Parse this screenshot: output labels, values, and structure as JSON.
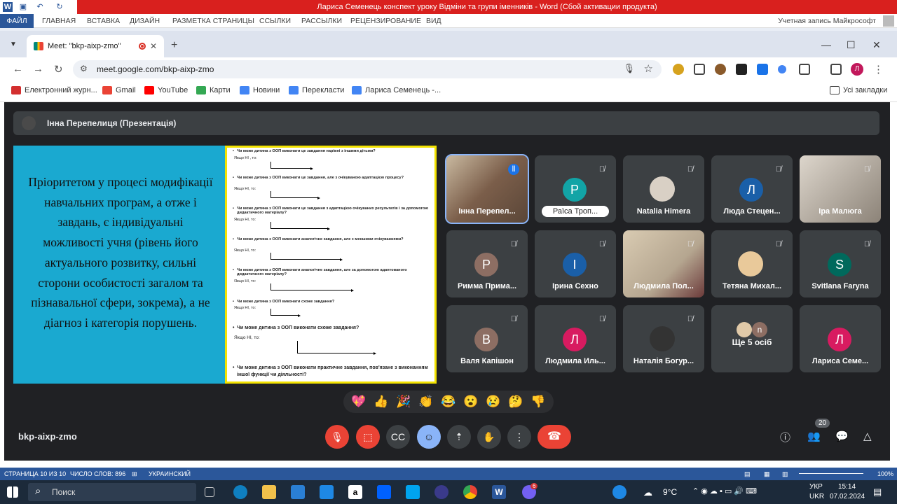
{
  "word": {
    "title": "Лариса Семенець конспект уроку Відміни та групи іменників  -  Word (Сбой активации продукта)",
    "file_tab": "ФАЙЛ",
    "tabs": [
      "ГЛАВНАЯ",
      "ВСТАВКА",
      "ДИЗАЙН",
      "РАЗМЕТКА СТРАНИЦЫ",
      "ССЫЛКИ",
      "РАССЫЛКИ",
      "РЕЦЕНЗИРОВАНИЕ",
      "ВИД"
    ],
    "account": "Учетная запись Майкрософт",
    "status": {
      "page": "СТРАНИЦА 10 ИЗ 10",
      "words": "ЧИСЛО СЛОВ: 896",
      "language": "УКРАИНСКИЙ",
      "zoom": "100%"
    }
  },
  "browser": {
    "tab_title": "Meet: \"bkp-aixp-zmo\"",
    "url": "meet.google.com/bkp-aixp-zmo",
    "profile_letter": "Л",
    "bookmarks": [
      "Електронний журн...",
      "Gmail",
      "YouTube",
      "Карти",
      "Новини",
      "Перекласти",
      "Лариса Семенець -..."
    ],
    "all_bookmarks": "Усі закладки"
  },
  "meet": {
    "presenter": "Інна Перепелиця (Презентація)",
    "slide_text": "Пріоритетом у процесі модифікації навчальних програм, а отже і завдань, є індивідуальні можливості учня  (рівень його актуального розвитку, сильні сторони особистості загалом та пізнавальної сфери, зокрема), а не діагноз і категорія порушень.",
    "doc": {
      "q1": "Чи може дитина з ООП виконати це завдання нарівні з іншими дітьми?",
      "a1": "Якщо НІ , то:",
      "q2": "Чи може дитина з ООП виконати це завдання, але з очікуваною адаптацією процесу?",
      "a2": "Якщо НІ, то:",
      "q3": "Чи може дитина з ООП виконати це завдання з адаптацією очікуваних результатів і за допомогою дидактичного матеріалу?",
      "a3": "Якщо НІ, то:",
      "q4": "Чи може дитина з ООП виконати аналогічне завдання, але з меншими очікуваннями?",
      "a4": "Якщо НІ, то:",
      "q5": "Чи може дитина з ООП виконати аналогічне завдання, але за допомогою адаптованого дидактичного матеріалу?",
      "a5": "Якщо НІ, то:",
      "q6": "Чи може дитина з ООП виконати схоже завдання?",
      "a6": "Якщо НІ, то:",
      "q7": "Чи може дитина з ООП виконати схоже завдання?",
      "a7": "Якщо НІ, то:",
      "q8": "Чи може дитина з ООП виконати практичне завдання, пов'язане з виконанням іншої функції чи діяльності?"
    },
    "participants": [
      {
        "name": "Інна Перепел...",
        "letter": "",
        "color": "#7b5e4a"
      },
      {
        "name": "Раїса Троп...",
        "letter": "Р",
        "color": "#12a4a6"
      },
      {
        "name": "Natalia Himera",
        "letter": "",
        "color": "#d9d0c5"
      },
      {
        "name": "Люда Стецен...",
        "letter": "Л",
        "color": "#1a5fa8"
      },
      {
        "name": "Іра Малюга",
        "letter": "",
        "color": "#8c8378"
      },
      {
        "name": "Римма Прима...",
        "letter": "Р",
        "color": "#8d6e63"
      },
      {
        "name": "Ірина Сехно",
        "letter": "І",
        "color": "#1a5fa8"
      },
      {
        "name": "Людмила Пол...",
        "letter": "",
        "color": "#b5a690"
      },
      {
        "name": "Тетяна Михал...",
        "letter": "",
        "color": "#e9c99a"
      },
      {
        "name": "Svitlana Faryna",
        "letter": "S",
        "color": "#00695c"
      },
      {
        "name": "Валя Капішон",
        "letter": "В",
        "color": "#8d6e63"
      },
      {
        "name": "Людмила Иль...",
        "letter": "Л",
        "color": "#d81b60"
      },
      {
        "name": "Наталія Богур...",
        "letter": "",
        "color": "#333333"
      },
      {
        "name": "Ще 5 осіб",
        "letter": "n",
        "color": "#8d6e63"
      },
      {
        "name": "Лариса Семе...",
        "letter": "Л",
        "color": "#d81b60"
      }
    ],
    "reactions": [
      "💖",
      "👍",
      "🎉",
      "👏",
      "😂",
      "😮",
      "😢",
      "🤔",
      "👎"
    ],
    "meeting_code": "bkp-aixp-zmo",
    "people_count": "20"
  },
  "taskbar": {
    "search": "Поиск",
    "temperature": "9°C",
    "lang1": "УКР",
    "lang2": "UKR",
    "time": "15:14",
    "date": "07.02.2024",
    "badge": "6"
  }
}
